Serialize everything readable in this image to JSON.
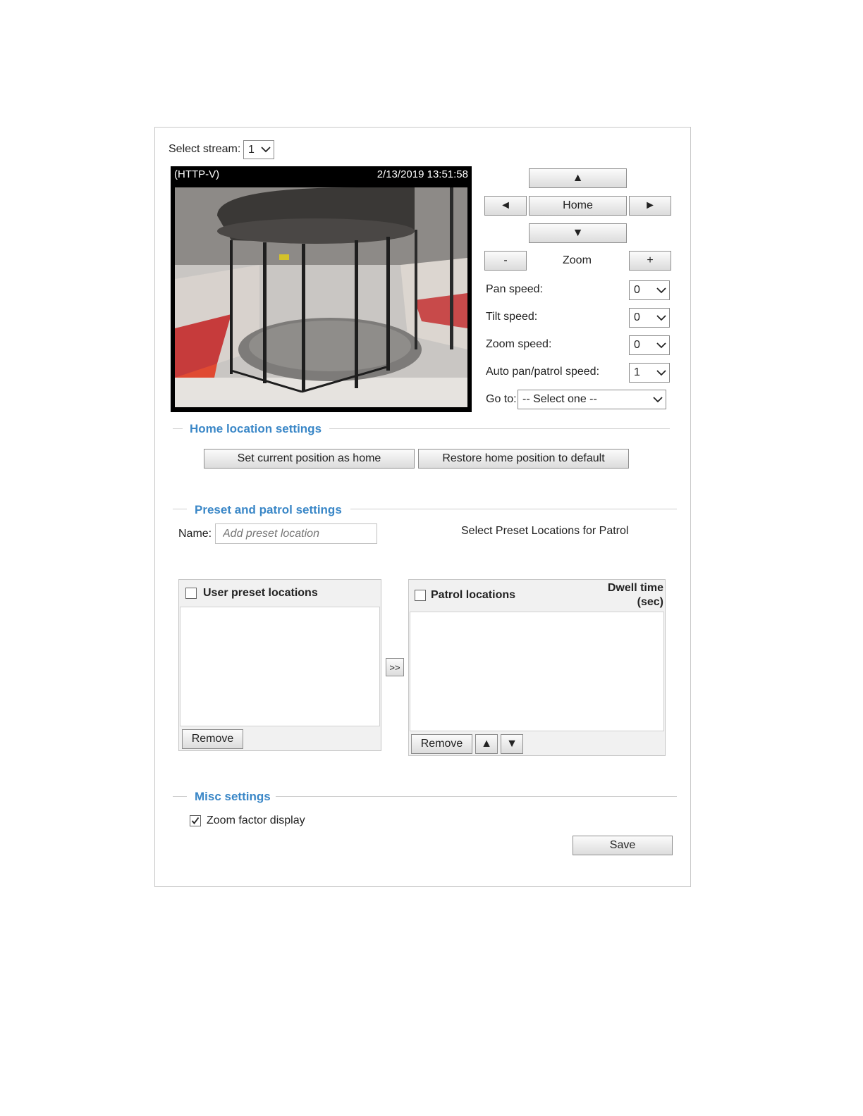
{
  "stream": {
    "label": "Select stream:",
    "value": "1"
  },
  "video": {
    "protocol": "(HTTP-V)",
    "timestamp": "2/13/2019 13:51:58"
  },
  "ptz": {
    "up": "▲",
    "left": "◄",
    "home": "Home",
    "right": "►",
    "down": "▼",
    "zoom_out": "-",
    "zoom_label": "Zoom",
    "zoom_in": "+",
    "pan_speed_label": "Pan speed:",
    "pan_speed": "0",
    "tilt_speed_label": "Tilt speed:",
    "tilt_speed": "0",
    "zoom_speed_label": "Zoom speed:",
    "zoom_speed": "0",
    "auto_speed_label": "Auto pan/patrol speed:",
    "auto_speed": "1",
    "goto_label": "Go to:",
    "goto_value": "-- Select one --"
  },
  "home_section": {
    "title": "Home location settings",
    "set_home": "Set current position as home",
    "restore_home": "Restore home position to default"
  },
  "preset_section": {
    "title": "Preset and patrol settings",
    "name_label": "Name:",
    "name_placeholder": "Add preset location",
    "patrol_hint": "Select Preset Locations for Patrol",
    "user_presets_header": "User preset locations",
    "patrol_header": "Patrol locations",
    "dwell_line1": "Dwell time",
    "dwell_line2": "(sec)",
    "move_button": ">>",
    "remove_left": "Remove",
    "remove_right": "Remove",
    "move_up": "▲",
    "move_down": "▼"
  },
  "misc_section": {
    "title": "Misc settings",
    "zoom_factor_label": "Zoom factor display",
    "zoom_factor_checked": true
  },
  "save_label": "Save"
}
